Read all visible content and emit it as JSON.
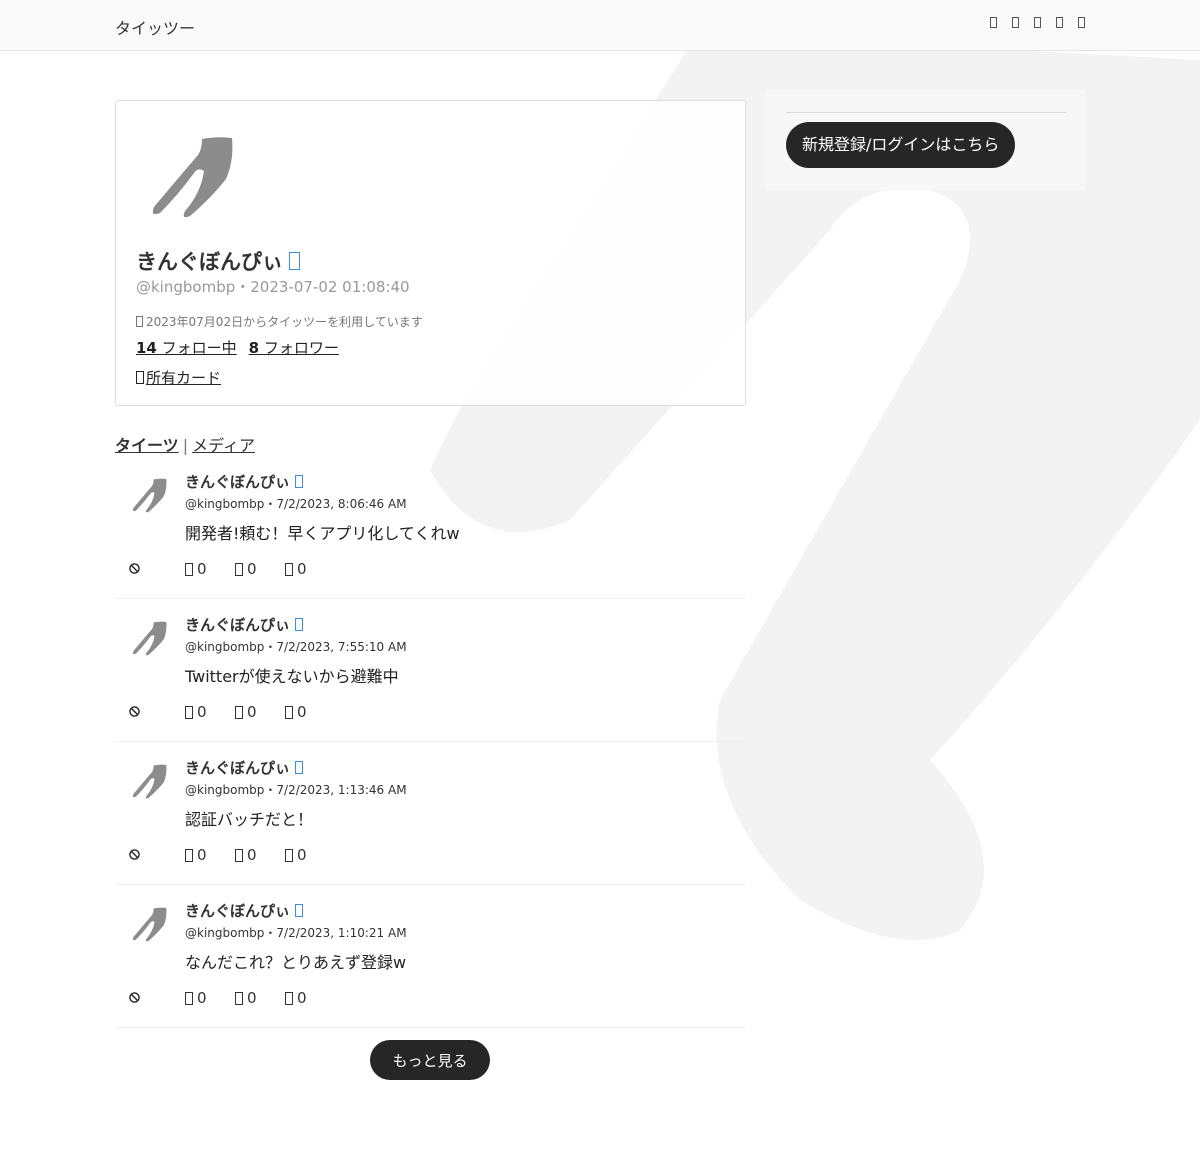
{
  "header": {
    "brand": "タイッツー",
    "nav_icons": [
      "home-icon",
      "search-icon",
      "bell-icon",
      "mail-icon",
      "user-icon"
    ]
  },
  "profile": {
    "display_name": "きんぐぼんぴぃ",
    "handle_date": "@kingbombp・2023-07-02 01:08:40",
    "since_text": "2023年07月02日からタイッツーを利用しています",
    "following_count": "14",
    "following_label": "フォロー中",
    "followers_count": "8",
    "followers_label": "フォロワー",
    "cards_label": "所有カード"
  },
  "sidebar": {
    "login_label": "新規登録/ログインはこちら"
  },
  "tabs": {
    "items": [
      {
        "label": "タイーツ",
        "active": true
      },
      {
        "label": "メディア",
        "active": false
      }
    ],
    "separator": "|"
  },
  "posts": [
    {
      "name": "きんぐぼんぴぃ",
      "meta": "@kingbombp・7/2/2023, 8:06:46 AM",
      "text": "開発者!頼む！早くアプリ化してくれw",
      "reply": "0",
      "repost": "0",
      "like": "0"
    },
    {
      "name": "きんぐぼんぴぃ",
      "meta": "@kingbombp・7/2/2023, 7:55:10 AM",
      "text": "Twitterが使えないから避難中",
      "reply": "0",
      "repost": "0",
      "like": "0"
    },
    {
      "name": "きんぐぼんぴぃ",
      "meta": "@kingbombp・7/2/2023, 1:13:46 AM",
      "text": "認証バッチだと！",
      "reply": "0",
      "repost": "0",
      "like": "0"
    },
    {
      "name": "きんぐぼんぴぃ",
      "meta": "@kingbombp・7/2/2023, 1:10:21 AM",
      "text": "なんだこれ？とりあえず登録w",
      "reply": "0",
      "repost": "0",
      "like": "0"
    }
  ],
  "more_label": "もっと見る",
  "colors": {
    "accent_badge": "#3b8ed8",
    "button_bg": "#262626",
    "background_mark": "#f2f2f2"
  }
}
